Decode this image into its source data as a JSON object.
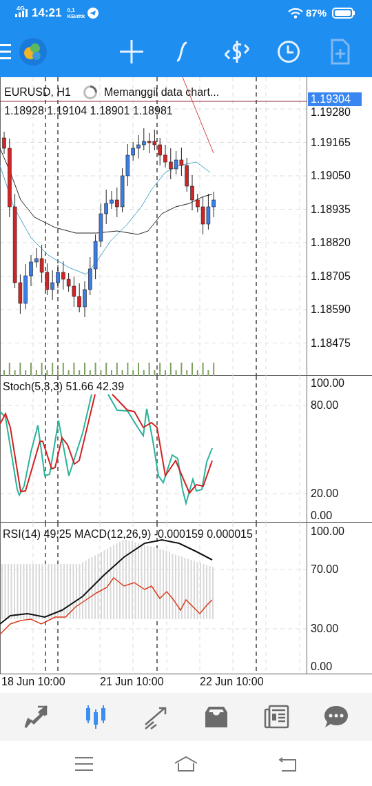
{
  "status_bar": {
    "network": "4G",
    "time": "14:21",
    "speed": "0,1",
    "speed_unit": "KB/dtk",
    "battery": "87%"
  },
  "chart": {
    "symbol": "EURUSD, H1",
    "loading": "Memanggil data chart...",
    "ohlc": "1.18928 1.19104 1.18901 1.18981",
    "current_price": "1.19304",
    "price_ticks": [
      "1.19280",
      "1.19165",
      "1.19050",
      "1.18935",
      "1.18820",
      "1.18705",
      "1.18590",
      "1.18475"
    ],
    "stoch_label": "Stoch(5,3,3) 51.66 42.39",
    "stoch_ticks": [
      "100.00",
      "80.00",
      "20.00",
      "0.00"
    ],
    "rsi_label": "RSI(14) 49.25 MACD(12,26,9) -0.000159 0.000015",
    "rsi_ticks": [
      "100.00",
      "70.00",
      "30.00",
      "0.00"
    ],
    "time_labels": [
      "18 Jun 10:00",
      "21 Jun 10:00",
      "22 Jun 10:00"
    ]
  },
  "bottom_nav": [
    {
      "kind": "quotes",
      "selected": false
    },
    {
      "kind": "chart",
      "selected": true
    },
    {
      "kind": "trade",
      "selected": false
    },
    {
      "kind": "history",
      "selected": false
    },
    {
      "kind": "news",
      "selected": false
    },
    {
      "kind": "messages",
      "selected": false
    }
  ]
}
